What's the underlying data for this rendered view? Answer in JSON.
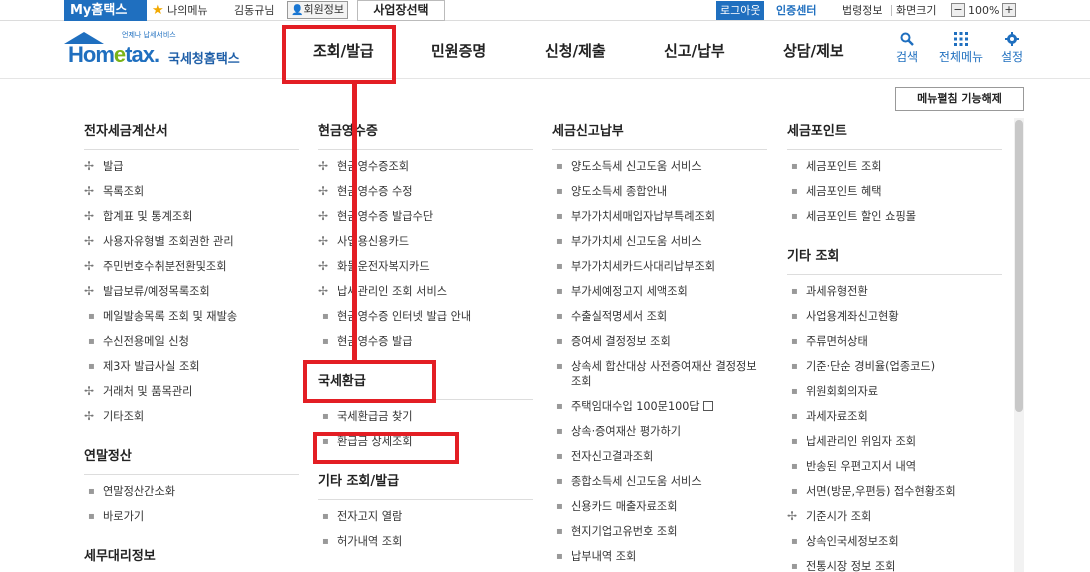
{
  "topbar": {
    "my_hometax": "My홈택스",
    "my_menu": "나의메뉴",
    "user_name": "김동규님",
    "member_info": "회원정보",
    "business_select": "사업장선택",
    "logout": "로그아웃",
    "cert_center": "인증센터",
    "law_info": "법령정보",
    "screen_size": "화면크기",
    "zoom_minus": "−",
    "zoom_value": "100%",
    "zoom_plus": "+"
  },
  "logo": {
    "tagline": "언제나 납세서비스",
    "brand_part1": "Hom",
    "brand_e": "e",
    "brand_part2": "tax.",
    "korean_name": "국세청홈택스"
  },
  "gnb": {
    "items": [
      "조회/발급",
      "민원증명",
      "신청/제출",
      "신고/납부",
      "상담/제보"
    ],
    "search": "검색",
    "all_menu": "전체메뉴",
    "settings": "설정"
  },
  "unfold_button": "메뉴펼침 기능해제",
  "columns": [
    {
      "title": "전자세금계산서",
      "items": [
        "발급",
        "목록조회",
        "합계표 및 통계조회",
        "사용자유형별 조회권한 관리",
        "주민번호수취분전환및조회",
        "발급보류/예정목록조회",
        "메일발송목록 조회 및 재발송",
        "수신전용메일 신청",
        "제3자 발급사실 조회",
        "거래처 및 품목관리",
        "기타조회"
      ],
      "section2_title": "연말정산",
      "section2_items": [
        "연말정산간소화",
        "바로가기"
      ],
      "section3_title": "세무대리정보"
    },
    {
      "title": "현금영수증",
      "items": [
        "현금영수증조회",
        "현금영수증 수정",
        "현금영수증 발급수단",
        "사업용신용카드",
        "화물운전자복지카드",
        "납세관리인 조회 서비스",
        "현금영수증 인터넷 발급 안내",
        "현금영수증 발급"
      ],
      "section2_title": "국세환급",
      "section2_items": [
        "국세환급금 찾기",
        "환급금 상세조회"
      ],
      "section3_title": "기타 조회/발급",
      "section3_items": [
        "전자고지 열람",
        "허가내역 조회"
      ]
    },
    {
      "title": "세금신고납부",
      "items": [
        "양도소득세 신고도움 서비스",
        "양도소득세 종합안내",
        "부가가치세매입자납부특례조회",
        "부가가치세 신고도움 서비스",
        "부가가치세카드사대리납부조회",
        "부가세예정고지 세액조회",
        "수출실적명세서 조회",
        "증여세 결정정보 조회",
        "상속세 합산대상 사전증여재산 결정정보 조회",
        "주택임대수입 100문100답",
        "상속·증여재산 평가하기",
        "전자신고결과조회",
        "종합소득세 신고도움 서비스",
        "신용카드 매출자료조회",
        "현지기업고유번호 조회",
        "납부내역 조회"
      ]
    },
    {
      "title": "세금포인트",
      "items": [
        "세금포인트 조회",
        "세금포인트 혜택",
        "세금포인트 할인 쇼핑몰"
      ],
      "section2_title": "기타 조회",
      "section2_items": [
        "과세유형전환",
        "사업용계좌신고현황",
        "주류면허상태",
        "기준·단순 경비율(업종코드)",
        "위원회회의자료",
        "과세자료조회",
        "납세관리인 위임자 조회",
        "반송된 우편고지서 내역",
        "서면(방문,우편등) 접수현황조회",
        "기준시가 조회",
        "상속인국세정보조회",
        "전통시장 정보 조회"
      ]
    }
  ],
  "colors": {
    "brand_blue": "#1f6fbf",
    "annotation_red": "#e31e24"
  }
}
